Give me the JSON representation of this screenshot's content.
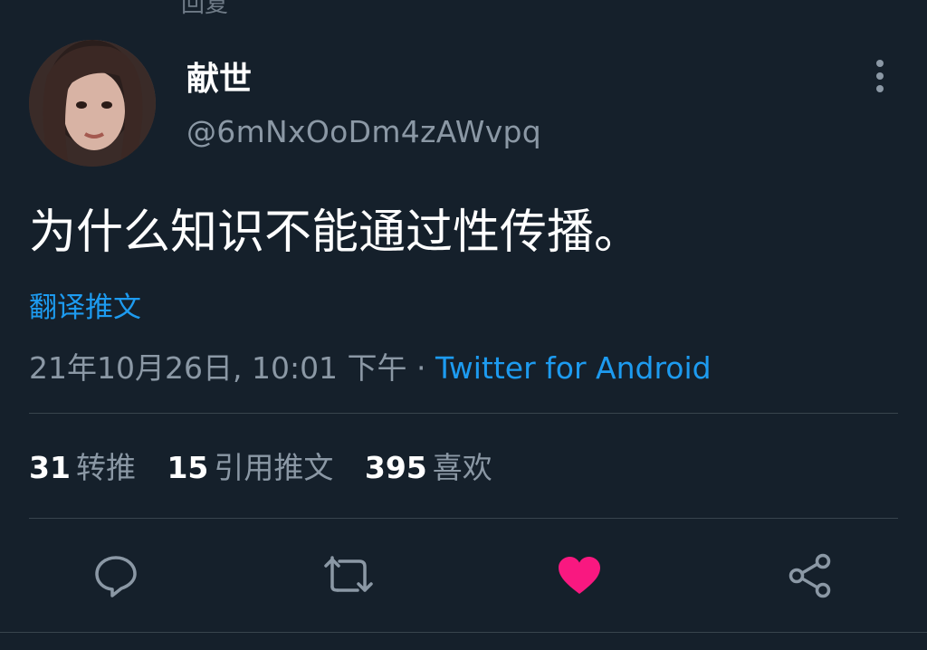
{
  "top_cut_text": "回复",
  "tweet": {
    "display_name": "献世",
    "handle": "@6mNxOoDm4zAWvpq",
    "text": "为什么知识不能通过性传播。",
    "translate_label": "翻译推文",
    "timestamp": "21年10月26日, 10:01 下午",
    "separator": "·",
    "source": "Twitter for Android"
  },
  "stats": {
    "retweets": {
      "count": "31",
      "label": "转推"
    },
    "quotes": {
      "count": "15",
      "label": "引用推文"
    },
    "likes": {
      "count": "395",
      "label": "喜欢"
    }
  },
  "actions": [
    {
      "icon": "reply-icon"
    },
    {
      "icon": "retweet-icon"
    },
    {
      "icon": "heart-icon",
      "liked": true
    },
    {
      "icon": "share-icon"
    }
  ],
  "colors": {
    "background": "#15202b",
    "accent": "#1d9bf0",
    "like": "#f91880",
    "muted": "#8b98a5"
  }
}
